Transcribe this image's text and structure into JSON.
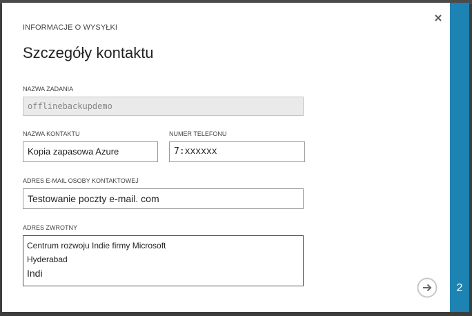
{
  "dialog": {
    "breadcrumb": "INFORMACJE O WYSYŁKI",
    "title": "Szczegóły kontaktu",
    "step": "2"
  },
  "icons": {
    "close": "close-icon",
    "next": "arrow-right-circle-icon"
  },
  "form": {
    "job_name": {
      "label": "NAZWA ZADANIA",
      "value": "offlinebackupdemo"
    },
    "contact_name": {
      "label": "NAZWA KONTAKTU",
      "value": "Kopia zapasowa Azure"
    },
    "phone": {
      "label": "NUMER TELEFONU",
      "value": "7:xxxxxx"
    },
    "email": {
      "label": "ADRES E-MAIL OSOBY KONTAKTOWEJ",
      "value": "Testowanie poczty e-mail. com"
    },
    "return_address": {
      "label": "ADRES ZWROTNY",
      "line1": "Centrum rozwoju Indie firmy Microsoft",
      "line2": "Hyderabad",
      "line3": "Indi"
    }
  },
  "colors": {
    "accent": "#1c83b2",
    "background": "#3d3d3d"
  }
}
